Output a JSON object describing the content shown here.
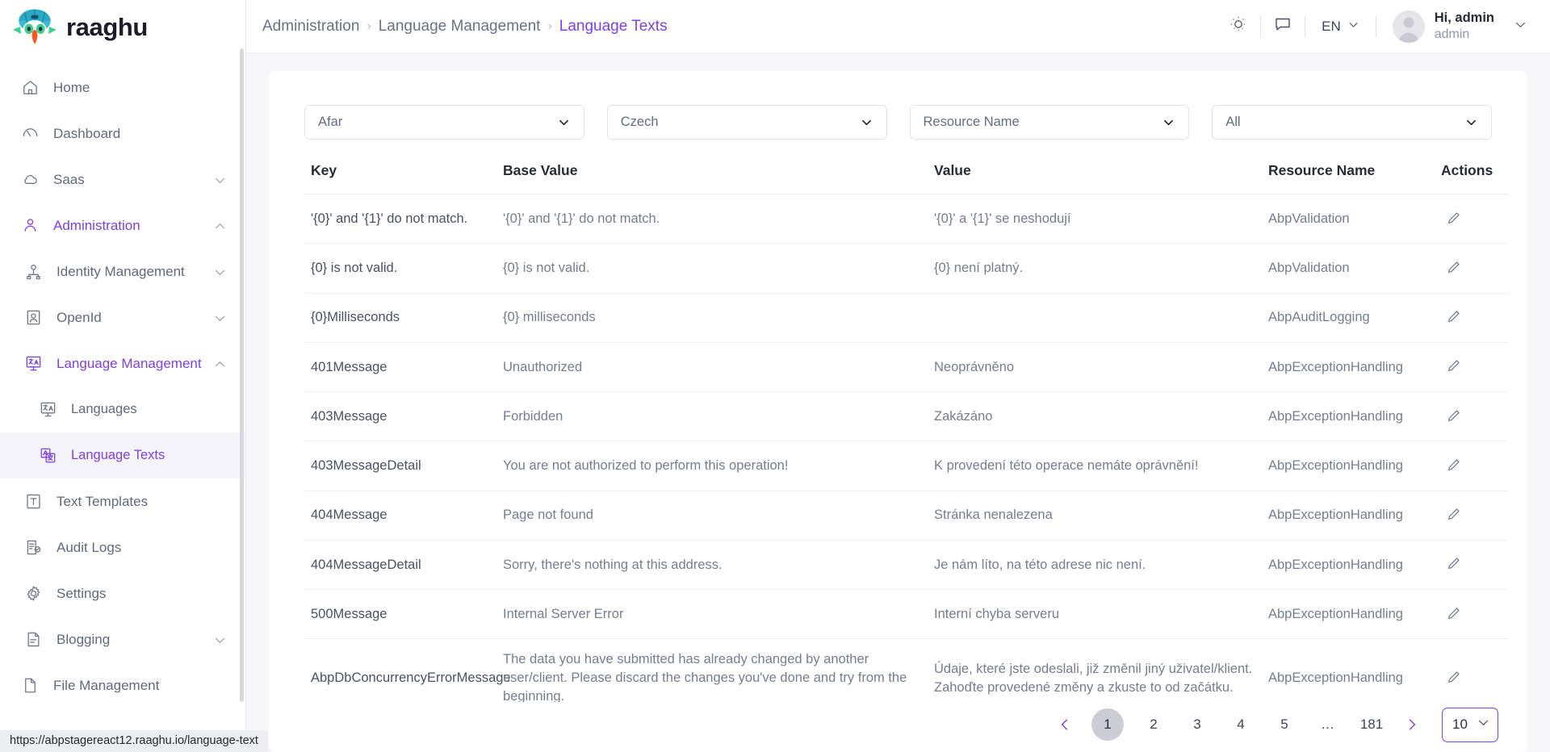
{
  "brand": {
    "name": "raaghu",
    "logo_icon": "raaghu-bird-logo"
  },
  "sidebar": {
    "items": [
      {
        "label": "Home",
        "icon": "home-icon",
        "level": 0,
        "chevron": false,
        "active": false,
        "selected": false
      },
      {
        "label": "Dashboard",
        "icon": "dashboard-icon",
        "level": 0,
        "chevron": false,
        "active": false,
        "selected": false
      },
      {
        "label": "Saas",
        "icon": "cloud-icon",
        "level": 0,
        "chevron": "down",
        "active": false,
        "selected": false
      },
      {
        "label": "Administration",
        "icon": "user-group-icon",
        "level": 0,
        "chevron": "up",
        "active": true,
        "selected": false
      },
      {
        "label": "Identity Management",
        "icon": "identity-icon",
        "level": 1,
        "chevron": "down",
        "active": false,
        "selected": false
      },
      {
        "label": "OpenId",
        "icon": "openid-icon",
        "level": 1,
        "chevron": "down",
        "active": false,
        "selected": false
      },
      {
        "label": "Language Management",
        "icon": "translate-icon",
        "level": 1,
        "chevron": "up",
        "active": true,
        "selected": false
      },
      {
        "label": "Languages",
        "icon": "translate-icon",
        "level": 2,
        "chevron": false,
        "active": false,
        "selected": false
      },
      {
        "label": "Language Texts",
        "icon": "language-text-icon",
        "level": 2,
        "chevron": false,
        "active": true,
        "selected": true
      },
      {
        "label": "Text Templates",
        "icon": "text-template-icon",
        "level": 1,
        "chevron": false,
        "active": false,
        "selected": false
      },
      {
        "label": "Audit Logs",
        "icon": "audit-log-icon",
        "level": 1,
        "chevron": false,
        "active": false,
        "selected": false
      },
      {
        "label": "Settings",
        "icon": "gear-icon",
        "level": 1,
        "chevron": false,
        "active": false,
        "selected": false
      },
      {
        "label": "Blogging",
        "icon": "blog-icon",
        "level": 1,
        "chevron": "down",
        "active": false,
        "selected": false
      },
      {
        "label": "File Management",
        "icon": "file-icon",
        "level": 0,
        "chevron": false,
        "active": false,
        "selected": false
      }
    ]
  },
  "header": {
    "breadcrumb": [
      {
        "label": "Administration",
        "current": false
      },
      {
        "label": "Language Management",
        "current": false
      },
      {
        "label": "Language Texts",
        "current": true
      }
    ],
    "separator": "›",
    "theme_icon": "sun-icon",
    "chat_icon": "chat-bubble-icon",
    "language": "EN",
    "language_caret_icon": "chevron-down-icon",
    "avatar_icon": "avatar-icon",
    "greeting": "Hi, admin",
    "username": "admin",
    "profile_caret_icon": "chevron-down-icon"
  },
  "filters": [
    {
      "name": "source-language",
      "value": "Afar",
      "caret_icon": "chevron-down-icon"
    },
    {
      "name": "target-language",
      "value": "Czech",
      "caret_icon": "chevron-down-icon"
    },
    {
      "name": "resource-name",
      "value": "Resource Name",
      "caret_icon": "chevron-down-icon"
    },
    {
      "name": "status",
      "value": "All",
      "caret_icon": "chevron-down-icon"
    }
  ],
  "table": {
    "columns": [
      "Key",
      "Base Value",
      "Value",
      "Resource Name",
      "Actions"
    ],
    "edit_icon": "pencil-icon",
    "rows": [
      {
        "key": "'{0}' and '{1}' do not match.",
        "base_value": "'{0}' and '{1}' do not match.",
        "value": "'{0}' a '{1}' se neshodují",
        "resource_name": "AbpValidation"
      },
      {
        "key": "{0} is not valid.",
        "base_value": "{0} is not valid.",
        "value": "{0} není platný.",
        "resource_name": "AbpValidation"
      },
      {
        "key": "{0}Milliseconds",
        "base_value": "{0} milliseconds",
        "value": "",
        "resource_name": "AbpAuditLogging"
      },
      {
        "key": "401Message",
        "base_value": "Unauthorized",
        "value": "Neoprávněno",
        "resource_name": "AbpExceptionHandling"
      },
      {
        "key": "403Message",
        "base_value": "Forbidden",
        "value": "Zakázáno",
        "resource_name": "AbpExceptionHandling"
      },
      {
        "key": "403MessageDetail",
        "base_value": "You are not authorized to perform this operation!",
        "value": "K provedení této operace nemáte oprávnění!",
        "resource_name": "AbpExceptionHandling"
      },
      {
        "key": "404Message",
        "base_value": "Page not found",
        "value": "Stránka nenalezena",
        "resource_name": "AbpExceptionHandling"
      },
      {
        "key": "404MessageDetail",
        "base_value": "Sorry, there's nothing at this address.",
        "value": "Je nám líto, na této adrese nic není.",
        "resource_name": "AbpExceptionHandling"
      },
      {
        "key": "500Message",
        "base_value": "Internal Server Error",
        "value": "Interní chyba serveru",
        "resource_name": "AbpExceptionHandling"
      },
      {
        "key": "AbpDbConcurrencyErrorMessage",
        "base_value": "The data you have submitted has already changed by another user/client. Please discard the changes you've done and try from the beginning.",
        "value": "Údaje, které jste odeslali, již změnil jiný uživatel/klient. Zahoďte provedené změny a zkuste to od začátku.",
        "resource_name": "AbpExceptionHandling"
      }
    ]
  },
  "pagination": {
    "prev_icon": "chevron-left-icon",
    "next_icon": "chevron-right-icon",
    "pages": [
      "1",
      "2",
      "3",
      "4",
      "5",
      "…",
      "181"
    ],
    "current_page": "1",
    "page_size": "10",
    "page_size_caret_icon": "chevron-down-icon"
  },
  "status_bar": {
    "url": "https://abpstagereact12.raaghu.io/language-text"
  },
  "colors": {
    "accent": "#7b3ff2",
    "text": "#3f4456",
    "muted": "#777d90",
    "bg": "#f7f7fa"
  }
}
